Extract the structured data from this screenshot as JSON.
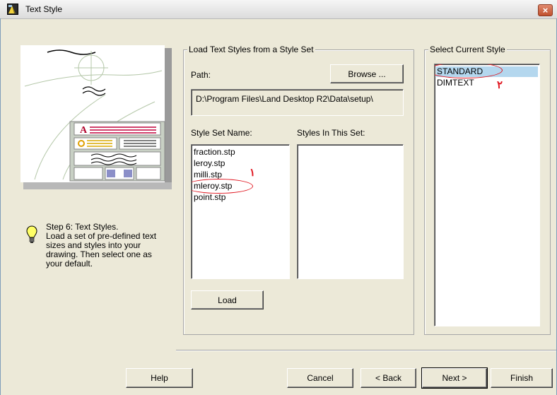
{
  "window": {
    "title": "Text Style",
    "close_label": "×"
  },
  "step": {
    "title": "Step 6:  Text Styles.",
    "lines": [
      "Load a set of pre-defined text",
      "sizes and styles into your",
      "drawing.  Then select one as",
      "your default."
    ]
  },
  "load_group": {
    "legend": "Load Text Styles from a Style Set",
    "path_label": "Path:",
    "browse_label": "Browse ...",
    "path_value": "D:\\Program Files\\Land Desktop R2\\Data\\setup\\",
    "style_set_label": "Style Set Name:",
    "styles_in_set_label": "Styles In This Set:",
    "style_sets": [
      "fraction.stp",
      "leroy.stp",
      "milli.stp",
      "mleroy.stp",
      "point.stp"
    ],
    "load_label": "Load"
  },
  "select_group": {
    "legend": "Select Current Style",
    "styles": [
      "STANDARD",
      "DIMTEXT"
    ]
  },
  "annotations": {
    "marker_1": "١",
    "marker_2": "٢"
  },
  "buttons": {
    "help": "Help",
    "cancel": "Cancel",
    "back": "< Back",
    "next": "Next >",
    "finish": "Finish"
  }
}
